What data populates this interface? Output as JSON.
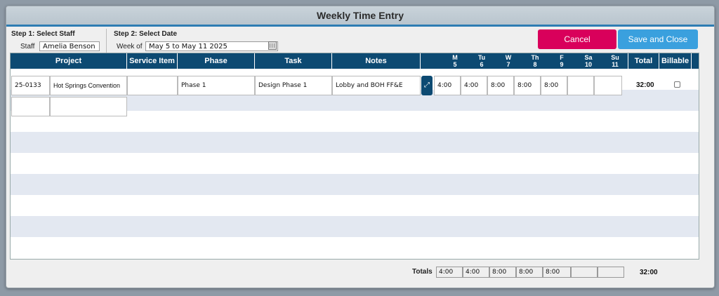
{
  "window": {
    "title": "Weekly Time Entry"
  },
  "step1": {
    "title": "Step 1: Select Staff",
    "staff_label": "Staff",
    "staff_value": "Amelia Benson"
  },
  "step2": {
    "title": "Step 2: Select Date",
    "week_label": "Week of",
    "week_value": "May 5 to May 11 2025"
  },
  "buttons": {
    "cancel": "Cancel",
    "save": "Save and Close"
  },
  "colors": {
    "header": "#0d4a72",
    "cancel": "#d9005b",
    "save": "#3aa0de",
    "stripe": "#e3e8f1"
  },
  "columns": {
    "project": "Project",
    "service": "Service Item",
    "phase": "Phase",
    "task": "Task",
    "notes": "Notes",
    "total": "Total",
    "billable": "Billable"
  },
  "days": [
    {
      "day": "M",
      "date": "5"
    },
    {
      "day": "Tu",
      "date": "6"
    },
    {
      "day": "W",
      "date": "7"
    },
    {
      "day": "Th",
      "date": "8"
    },
    {
      "day": "F",
      "date": "9"
    },
    {
      "day": "Sa",
      "date": "10"
    },
    {
      "day": "Su",
      "date": "11"
    }
  ],
  "rows": [
    {
      "project_code": "25-0133",
      "project_name": "Hot Springs Convention",
      "service": "",
      "phase": "Phase 1",
      "task": "Design Phase 1",
      "notes": "Lobby and BOH FF&E",
      "hours": [
        "4:00",
        "4:00",
        "8:00",
        "8:00",
        "8:00",
        "",
        ""
      ],
      "total": "32:00",
      "billable": false
    }
  ],
  "footer": {
    "totals_label": "Totals",
    "day_totals": [
      "4:00",
      "4:00",
      "8:00",
      "8:00",
      "8:00",
      "",
      ""
    ],
    "grand_total": "32:00"
  }
}
